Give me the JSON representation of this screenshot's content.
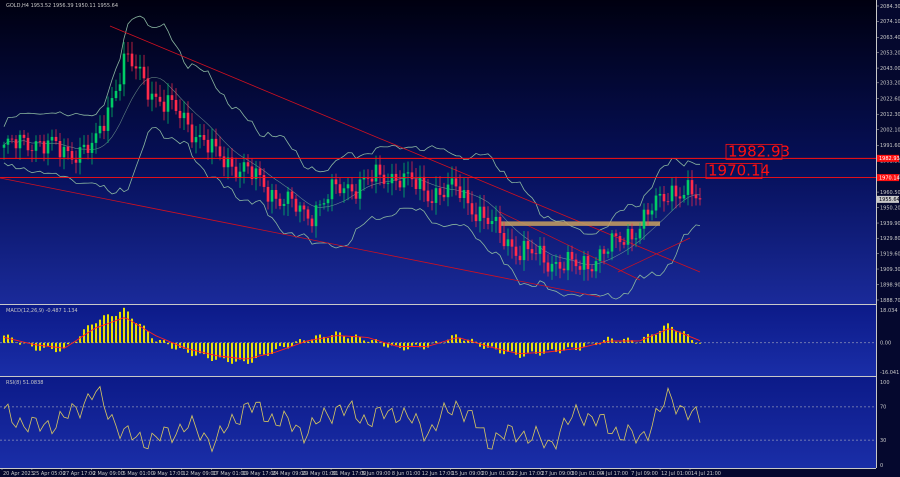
{
  "main_pane": {
    "title": "GOLD,H4  1953.52 1956.39 1950.11 1955.64",
    "hlines": [
      {
        "price": 1982.93,
        "label": "1982.93"
      },
      {
        "price": 1970.14,
        "label": "1970.14"
      }
    ],
    "price_ticks": [
      "2084.30",
      "2074.10",
      "2063.40",
      "2053.20",
      "2043.00",
      "2033.20",
      "2022.60",
      "2012.30",
      "2002.10",
      "1991.60",
      "1981.30",
      "1970.70",
      "1960.50",
      "1950.20",
      "1939.90",
      "1929.80",
      "1919.60",
      "1909.30",
      "1898.90",
      "1888.70"
    ],
    "current_price_badge": "1955.64",
    "level_badges": [
      "1982.93",
      "1970.14"
    ]
  },
  "macd_pane": {
    "title": "MACD(12,26,9) -0.487 1.134",
    "ticks": [
      "18.034",
      "0.00",
      "-16.041"
    ]
  },
  "rsi_pane": {
    "title": "RSI(8) 51.0838",
    "ticks": [
      "100",
      "70",
      "30",
      "0"
    ]
  },
  "time_axis": [
    "20 Apr 2023",
    "25 Apr 05:00",
    "27 Apr 17:00",
    "2 May 09:00",
    "5 May 01:00",
    "9 May 17:00",
    "12 May 09:00",
    "17 May 01:00",
    "19 May 17:00",
    "24 May 09:00",
    "29 May 01:00",
    "31 May 17:00",
    "5 Jun 09:00",
    "8 Jun 01:00",
    "12 Jun 17:00",
    "15 Jun 09:00",
    "20 Jun 01:00",
    "22 Jun 17:00",
    "27 Jun 09:00",
    "30 Jun 01:00",
    "4 Jul 17:00",
    "7 Jul 09:00",
    "12 Jul 01:00",
    "14 Jul 21:00"
  ],
  "colors": {
    "background_top": "#000010",
    "background_bottom": "#1a2a9a",
    "up_candle": "#00cc66",
    "down_candle": "#ff2a4a",
    "trendline": "#d01020",
    "band": "#8ab6a0",
    "macd_hist": "#e8e000",
    "macd_signal": "#ff2020",
    "rsi_line": "#d8c860",
    "level_line": "#ff1010",
    "zone": "#c8a060"
  },
  "chart_data": [
    {
      "type": "candlestick",
      "title": "GOLD,H4",
      "xlabel": "",
      "ylabel": "",
      "ylim": [
        1888.7,
        2084.3
      ],
      "x": [
        "20 Apr 2023",
        "25 Apr 05:00",
        "27 Apr 17:00",
        "2 May 09:00",
        "5 May 01:00",
        "9 May 17:00",
        "12 May 09:00",
        "17 May 01:00",
        "19 May 17:00",
        "24 May 09:00",
        "29 May 01:00",
        "31 May 17:00",
        "5 Jun 09:00",
        "8 Jun 01:00",
        "12 Jun 17:00",
        "15 Jun 09:00",
        "20 Jun 01:00",
        "22 Jun 17:00",
        "27 Jun 09:00",
        "30 Jun 01:00",
        "4 Jul 17:00",
        "7 Jul 09:00",
        "12 Jul 01:00",
        "14 Jul 21:00"
      ],
      "close": [
        1990,
        1995,
        1987,
        1990,
        2050,
        2025,
        2008,
        1985,
        1975,
        1958,
        1945,
        1962,
        1968,
        1972,
        1960,
        1962,
        1940,
        1922,
        1915,
        1910,
        1923,
        1938,
        1963,
        1955.64
      ],
      "levels": [
        1982.93,
        1970.14
      ],
      "zone": [
        1938,
        1941
      ],
      "grid": false
    },
    {
      "type": "bar",
      "title": "MACD(12,26,9) -0.487 1.134",
      "ylim": [
        -16.041,
        18.034
      ],
      "x": [
        "20 Apr 2023",
        "25 Apr 05:00",
        "27 Apr 17:00",
        "2 May 09:00",
        "5 May 01:00",
        "9 May 17:00",
        "12 May 09:00",
        "17 May 01:00",
        "19 May 17:00",
        "24 May 09:00",
        "29 May 01:00",
        "31 May 17:00",
        "5 Jun 09:00",
        "8 Jun 01:00",
        "12 Jun 17:00",
        "15 Jun 09:00",
        "20 Jun 01:00",
        "22 Jun 17:00",
        "27 Jun 09:00",
        "30 Jun 01:00",
        "4 Jul 17:00",
        "7 Jul 09:00",
        "12 Jul 01:00",
        "14 Jul 21:00"
      ],
      "histogram": [
        4,
        -3,
        -4,
        12,
        18,
        2,
        -5,
        -9,
        -11,
        -4,
        2,
        5,
        2,
        -3,
        -2,
        4,
        -3,
        -7,
        -5,
        -3,
        2,
        1,
        10,
        -0.487
      ],
      "signal": [
        3,
        -1,
        -3,
        8,
        14,
        4,
        -3,
        -7,
        -9,
        -5,
        1,
        4,
        3,
        -2,
        -2,
        3,
        -2,
        -6,
        -5,
        -3,
        1,
        1,
        8,
        1.134
      ]
    },
    {
      "type": "line",
      "title": "RSI(8) 51.0838",
      "ylim": [
        0,
        100
      ],
      "levels": [
        70,
        30
      ],
      "x": [
        "20 Apr 2023",
        "25 Apr 05:00",
        "27 Apr 17:00",
        "2 May 09:00",
        "5 May 01:00",
        "9 May 17:00",
        "12 May 09:00",
        "17 May 01:00",
        "19 May 17:00",
        "24 May 09:00",
        "29 May 01:00",
        "31 May 17:00",
        "5 Jun 09:00",
        "8 Jun 01:00",
        "12 Jun 17:00",
        "15 Jun 09:00",
        "20 Jun 01:00",
        "22 Jun 17:00",
        "27 Jun 09:00",
        "30 Jun 01:00",
        "4 Jul 17:00",
        "7 Jul 09:00",
        "12 Jul 01:00",
        "14 Jul 21:00"
      ],
      "values": [
        62,
        45,
        55,
        88,
        35,
        30,
        48,
        28,
        72,
        55,
        40,
        70,
        55,
        65,
        40,
        75,
        30,
        40,
        25,
        65,
        45,
        30,
        82,
        51.08
      ]
    }
  ]
}
